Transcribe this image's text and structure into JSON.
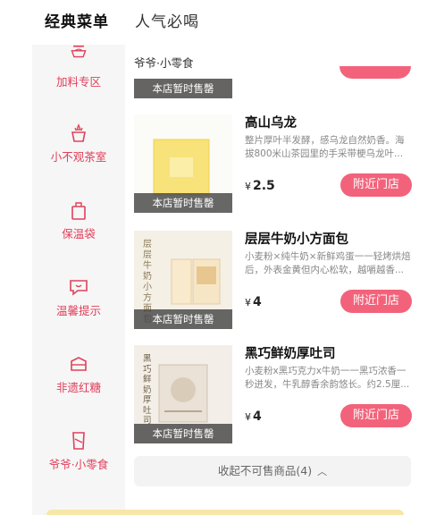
{
  "tabs": [
    {
      "label": "经典菜单",
      "active": true
    },
    {
      "label": "人气必喝",
      "active": false
    }
  ],
  "sidebar": {
    "items": [
      {
        "label": "加料专区",
        "icon": "bowl-icon"
      },
      {
        "label": "小不观茶室",
        "icon": "teacup-icon"
      },
      {
        "label": "保温袋",
        "icon": "bag-icon"
      },
      {
        "label": "温馨提示",
        "icon": "speech-bubble-icon"
      },
      {
        "label": "非遗红糖",
        "icon": "sugar-box-icon"
      },
      {
        "label": "爷爷·小零食",
        "icon": "snack-bag-icon"
      }
    ]
  },
  "main": {
    "section_title": "爷爷·小零食",
    "soldout_label": "本店暂时售罄",
    "products": [
      {
        "name": "高山乌龙",
        "description": "整片厚叶半发酵，感乌龙自然奶香。海拔800米山茶园里的手采带梗乌龙叶...",
        "currency": "¥",
        "price": "2.5",
        "button": "附近门店"
      },
      {
        "name": "层层牛奶小方面包",
        "description": "小麦粉×纯牛奶×新鲜鸡蛋一一轻烤烘焙后，外表金黄但内心松软，越嚼越香...",
        "currency": "¥",
        "price": "4",
        "button": "附近门店",
        "package_text": "层层牛奶小方面包"
      },
      {
        "name": "黑巧鲜奶厚吐司",
        "description": "小麦粉x黑巧克力x牛奶一一黑巧浓香一秒迸发，牛乳醇香余韵悠长。约2.5厘...",
        "currency": "¥",
        "price": "4",
        "button": "附近门店",
        "package_text": "黑巧鲜奶厚吐司"
      }
    ],
    "collapse_label": "收起不可售商品(4)",
    "collapse_icon": "chevron-up-icon"
  },
  "colors": {
    "accent": "#f2637b",
    "sidebar_label": "#e0405a",
    "sidebar_bg": "#f6f6f6",
    "soldout_overlay": "#464646"
  }
}
